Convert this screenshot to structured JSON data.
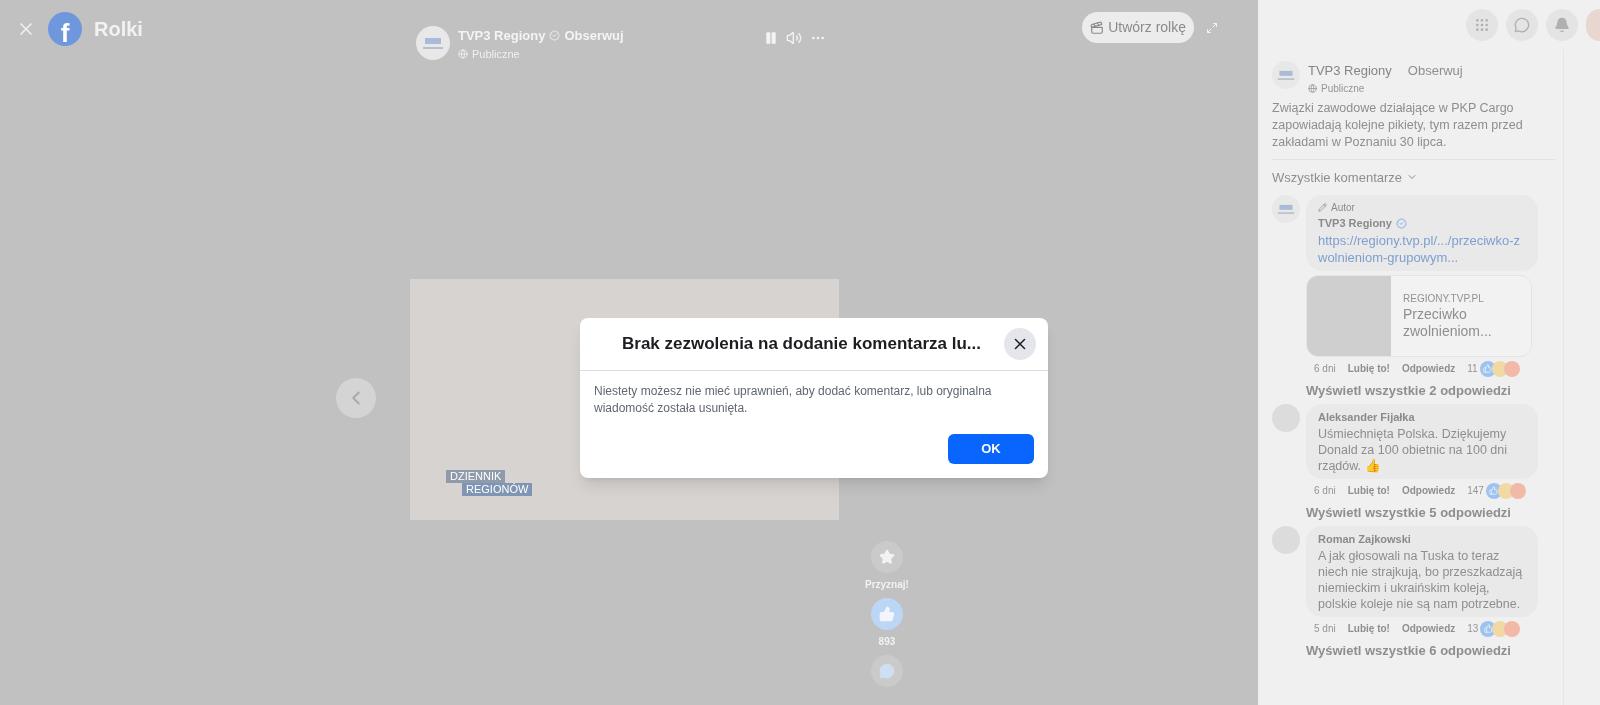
{
  "viewer": {
    "logo_letter": "f",
    "title": "Rolki",
    "create_button": "Utwórz rolkę"
  },
  "reel": {
    "page_name": "TVP3 Regiony",
    "follow": "Obserwuj",
    "audience": "Publiczne",
    "video_caption": [
      "DZIENNIK",
      "REGIONÓW"
    ],
    "actions": [
      {
        "kind": "star",
        "label": "Przyznaj!"
      },
      {
        "kind": "like",
        "label": "893"
      },
      {
        "kind": "comment"
      }
    ]
  },
  "post": {
    "page_name": "TVP3 Regiony",
    "follow": "Obserwuj",
    "audience": "Publiczne",
    "text": "Związki zawodowe działające w PKP Cargo zapowiadają kolejne pikiety, tym razem przed zakładami w Poznaniu 30 lipca."
  },
  "comments_filter": "Wszystkie komentarze",
  "comments": [
    {
      "kind": "author",
      "badge": "Autor",
      "name": "TVP3 Regiony",
      "verified": true,
      "link": "https://regiony.tvp.pl/.../przeciwko-zwolnieniom-grupowym...",
      "preview": {
        "domain": "REGIONY.TVP.PL",
        "title": "Przeciwko zwolnieniom..."
      },
      "age": "6 dni",
      "like": "Lubię to!",
      "reply": "Odpowiedz",
      "count": "11",
      "replies": "Wyświetl wszystkie 2 odpowiedzi"
    },
    {
      "kind": "user",
      "name": "Aleksander Fijałka",
      "verified": false,
      "text": "Uśmiechnięta Polska. Dziękujemy Donald za 100 obietnic na 100 dni rządów. 👍",
      "age": "6 dni",
      "like": "Lubię to!",
      "reply": "Odpowiedz",
      "count": "147",
      "replies": "Wyświetl wszystkie 5 odpowiedzi"
    },
    {
      "kind": "user",
      "name": "Roman Zajkowski",
      "verified": false,
      "text": "A jak głosowali na Tuska to teraz niech nie strajkują, bo przeszkadzają niemieckim i ukraińskim koleją, polskie koleje nie są nam potrzebne.",
      "age": "5 dni",
      "like": "Lubię to!",
      "reply": "Odpowiedz",
      "count": "13",
      "replies": "Wyświetl wszystkie 6 odpowiedzi"
    }
  ],
  "dialog": {
    "title": "Brak zezwolenia na dodanie komentarza lu...",
    "body": "Niestety możesz nie mieć uprawnień, aby dodać komentarz, lub oryginalna wiadomość została usunięta.",
    "ok": "OK"
  }
}
